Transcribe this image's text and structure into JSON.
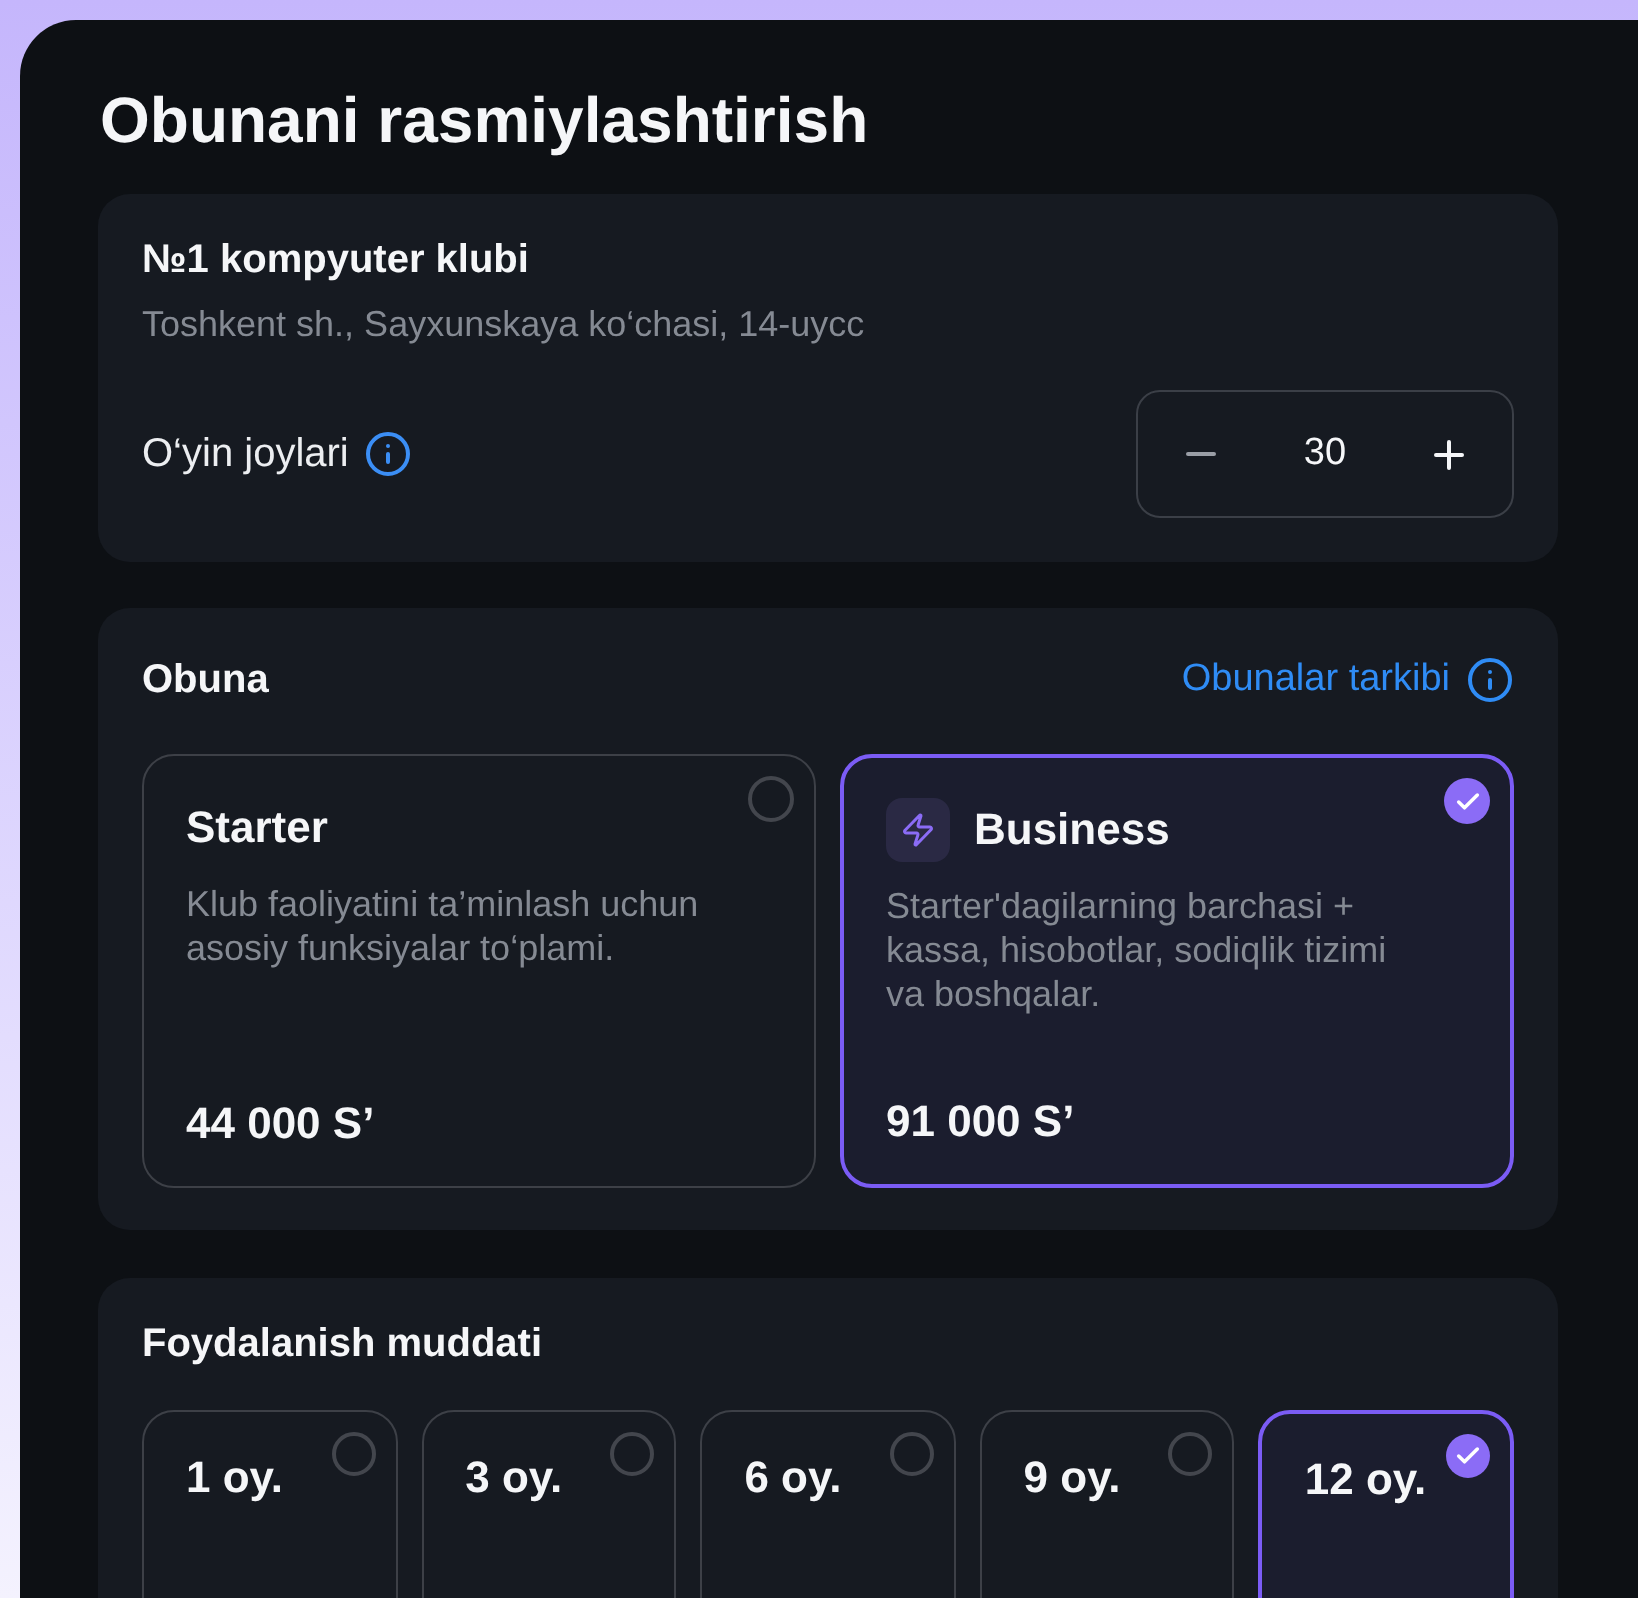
{
  "page": {
    "title": "Obunani rasmiylashtirish"
  },
  "club": {
    "name": "№1 kompyuter klubi",
    "address": "Toshkent sh., Sayxunskaya ko‘chasi, 14-uycc",
    "seats_label": "O‘yin joylari",
    "seats_value": "30"
  },
  "subscription": {
    "title": "Obuna",
    "details_link": "Obunalar tarkibi",
    "plans": [
      {
        "kind": "plain",
        "name": "Starter",
        "description": "Klub faoliyatini ta’minlash uchun asosiy funksiyalar to‘plami.",
        "price": "44 000 S’",
        "selected": false
      },
      {
        "kind": "bolt",
        "name": "Business",
        "description": "Starter'dagilarning barchasi + kassa, hisobotlar, sodiqlik tizimi va boshqalar.",
        "price": "91 000 S’",
        "selected": true
      }
    ]
  },
  "duration": {
    "title": "Foydalanish muddati",
    "options": [
      {
        "label": "1 oy.",
        "selected": false
      },
      {
        "label": "3 oy.",
        "selected": false
      },
      {
        "label": "6 oy.",
        "selected": false
      },
      {
        "label": "9 oy.",
        "selected": false
      },
      {
        "label": "12 oy.",
        "selected": true
      }
    ]
  }
}
